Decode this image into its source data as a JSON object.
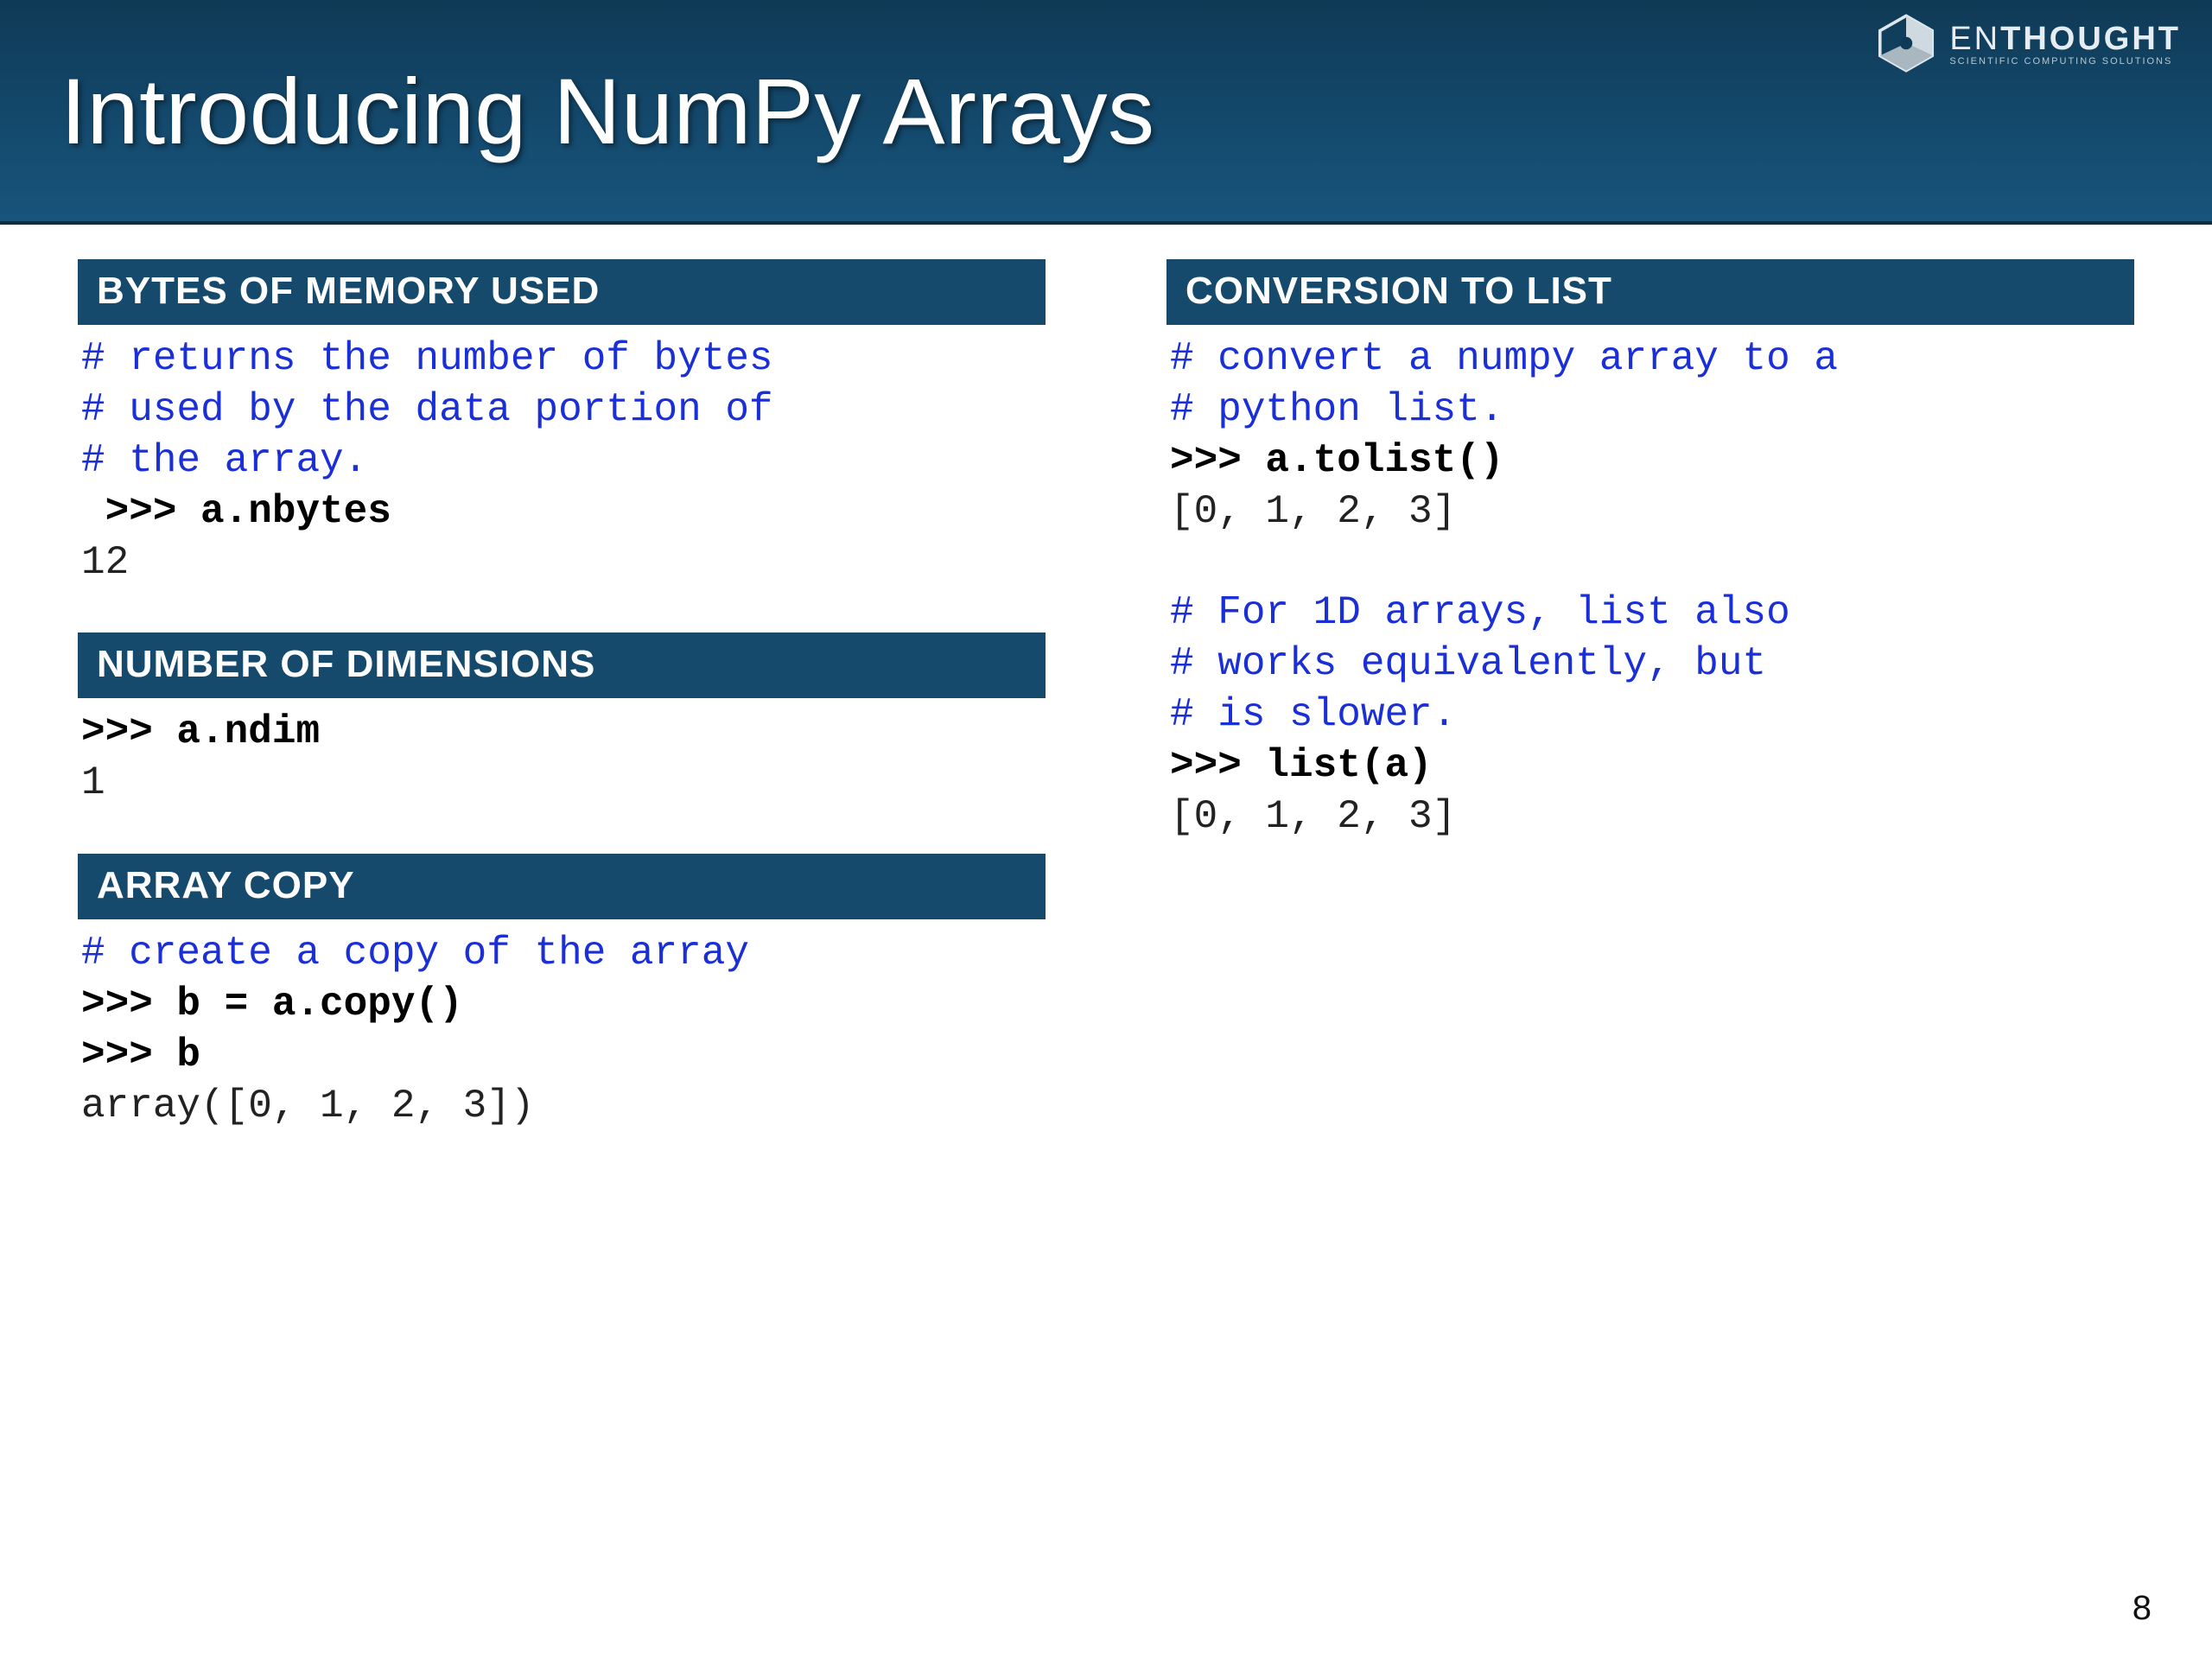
{
  "header": {
    "title": "Introducing NumPy Arrays",
    "brand_left": "EN",
    "brand_right": "THOUGHT",
    "tagline": "SCIENTIFIC COMPUTING SOLUTIONS"
  },
  "page_number": "8",
  "left": {
    "s1": {
      "title": "BYTES OF MEMORY USED",
      "l1": "# returns the number of bytes",
      "l2": "# used by the data portion of",
      "l3": "# the array.",
      "l4": " >>> a.nbytes",
      "l5": "12"
    },
    "s2": {
      "title": "NUMBER OF DIMENSIONS",
      "l1": ">>> a.ndim",
      "l2": "1"
    },
    "s3": {
      "title": "ARRAY COPY",
      "l1": "# create a copy of the array",
      "l2": ">>> b = a.copy()",
      "l3": ">>> b",
      "l4": "array([0, 1, 2, 3])"
    }
  },
  "right": {
    "s1": {
      "title": "CONVERSION TO LIST",
      "l1": "# convert a numpy array to a",
      "l2": "# python list.",
      "l3": ">>> a.tolist()",
      "l4": "[0, 1, 2, 3]",
      "l5": "",
      "l6": "# For 1D arrays, list also",
      "l7": "# works equivalently, but",
      "l8": "# is slower.",
      "l9": ">>> list(a)",
      "l10": "[0, 1, 2, 3]"
    }
  }
}
